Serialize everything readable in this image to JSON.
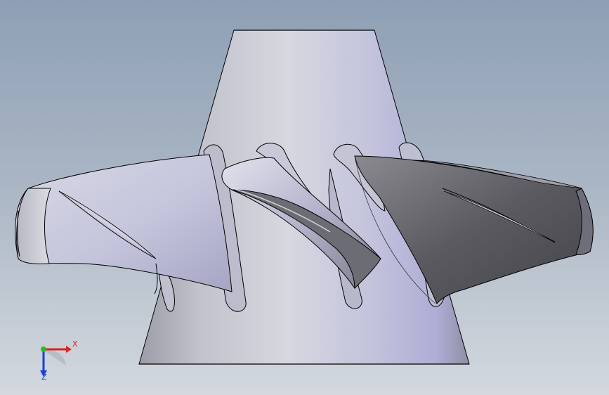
{
  "viewport": {
    "background_top": "#8e9fb5",
    "background_bottom": "#d3d8de"
  },
  "model": {
    "part": "runner-hub",
    "hub_color": "#c6c6d8",
    "blade_light": "#c8c8dc",
    "blade_dark": "#5e5e64",
    "edge_color": "#000000"
  },
  "triad": {
    "x_label": "X",
    "z_label": "Z",
    "x_color": "#e02020",
    "y_color": "#20c020",
    "z_color": "#1a3fd6"
  }
}
